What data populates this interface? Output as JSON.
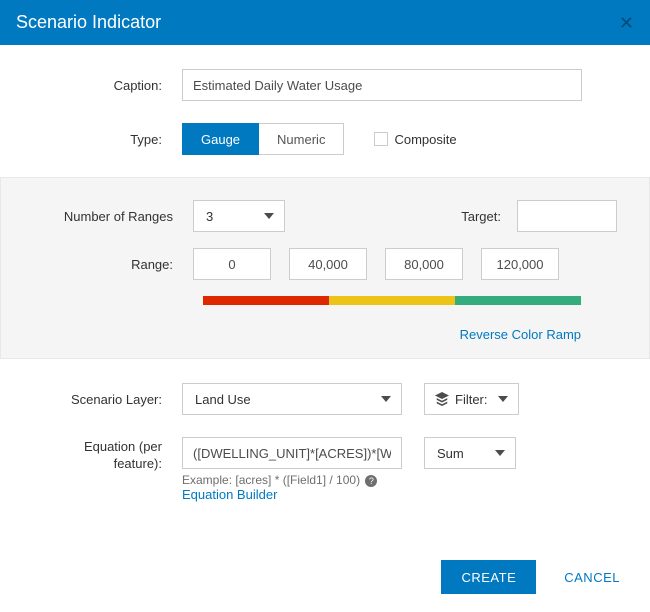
{
  "header": {
    "title": "Scenario Indicator"
  },
  "fields": {
    "caption_label": "Caption:",
    "caption_value": "Estimated Daily Water Usage",
    "type_label": "Type:",
    "type_gauge": "Gauge",
    "type_numeric": "Numeric",
    "composite_label": "Composite"
  },
  "ranges": {
    "num_label": "Number of Ranges",
    "num_value": "3",
    "target_label": "Target:",
    "target_value": "",
    "range_label": "Range:",
    "values": [
      "0",
      "40,000",
      "80,000",
      "120,000"
    ],
    "reverse_label": "Reverse Color Ramp"
  },
  "scenario": {
    "layer_label": "Scenario Layer:",
    "layer_value": "Land Use",
    "filter_label": "Filter:",
    "equation_label": "Equation (per feature):",
    "equation_value": "([DWELLING_UNIT]*[ACRES])*[WATER_PER_UNIT]",
    "agg_value": "Sum",
    "example": "Example: [acres] * ([Field1] / 100)",
    "builder_label": "Equation Builder"
  },
  "footer": {
    "create": "CREATE",
    "cancel": "CANCEL"
  }
}
